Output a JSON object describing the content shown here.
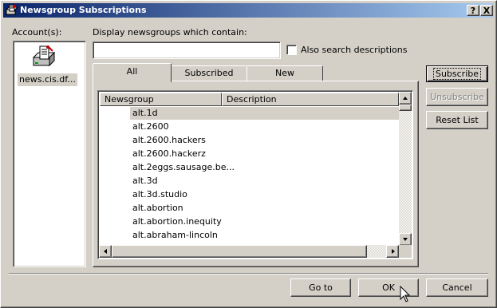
{
  "window": {
    "title": "Newsgroup Subscriptions",
    "help_label": "?",
    "close_label": "X"
  },
  "accounts": {
    "label": "Account(s):",
    "items": [
      {
        "name": "news.cis.df..."
      }
    ]
  },
  "filter": {
    "label": "Display newsgroups which contain:",
    "value": "",
    "also_search_label": "Also search descriptions",
    "also_search_checked": false
  },
  "tabs": [
    {
      "label": "All",
      "active": true
    },
    {
      "label": "Subscribed",
      "active": false
    },
    {
      "label": "New",
      "active": false
    }
  ],
  "list": {
    "columns": [
      "Newsgroup",
      "Description"
    ],
    "rows": [
      {
        "name": "alt.1d",
        "selected": true
      },
      {
        "name": "alt.2600"
      },
      {
        "name": "alt.2600.hackers"
      },
      {
        "name": "alt.2600.hackerz"
      },
      {
        "name": "alt.2eggs.sausage.be..."
      },
      {
        "name": "alt.3d"
      },
      {
        "name": "alt.3d.studio"
      },
      {
        "name": "alt.abortion"
      },
      {
        "name": "alt.abortion.inequity"
      },
      {
        "name": "alt.abraham-lincoln"
      }
    ]
  },
  "side_buttons": {
    "subscribe": "Subscribe",
    "unsubscribe": "Unsubscribe",
    "reset": "Reset List"
  },
  "footer": {
    "goto": "Go to",
    "ok": "OK",
    "cancel": "Cancel"
  },
  "icons": {
    "title_icon": "newsgroup-icon",
    "account_icon": "news-server-icon"
  }
}
